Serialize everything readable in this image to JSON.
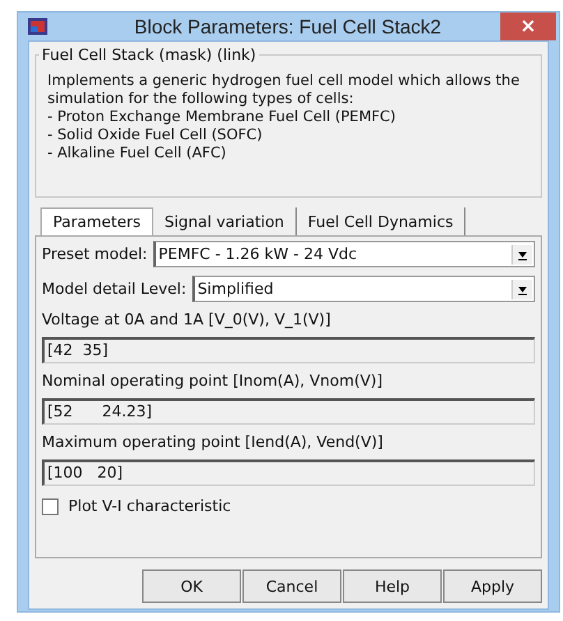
{
  "window": {
    "title": "Block Parameters: Fuel Cell Stack2",
    "close": "×"
  },
  "group": {
    "title": "Fuel Cell Stack (mask) (link)",
    "description": [
      "Implements a generic hydrogen fuel cell model which allows the simulation for the following types of cells:",
      "- Proton Exchange Membrane Fuel Cell (PEMFC)",
      "- Solid Oxide Fuel Cell (SOFC)",
      "- Alkaline Fuel Cell (AFC)"
    ]
  },
  "tabs": [
    {
      "label": "Parameters",
      "selected": true
    },
    {
      "label": "Signal variation",
      "selected": false
    },
    {
      "label": "Fuel Cell Dynamics",
      "selected": false
    }
  ],
  "params": [
    {
      "kind": "dropdown",
      "label": "Preset model:",
      "value": "PEMFC - 1.26 kW - 24 Vdc"
    },
    {
      "kind": "dropdown",
      "label": "Model detail Level:",
      "value": "Simplified"
    },
    {
      "kind": "field",
      "label": "Voltage at 0A and 1A [V_0(V), V_1(V)]",
      "value": "[42  35]"
    },
    {
      "kind": "field",
      "label": "Nominal operating point [Inom(A), Vnom(V)]",
      "value": "[52      24.23]"
    },
    {
      "kind": "field",
      "label": "Maximum operating point [Iend(A), Vend(V)]",
      "value": "[100   20]"
    },
    {
      "kind": "checkbox",
      "label": "Plot V-I characteristic",
      "checked": false
    }
  ],
  "buttons": [
    "OK",
    "Cancel",
    "Help",
    "Apply"
  ]
}
